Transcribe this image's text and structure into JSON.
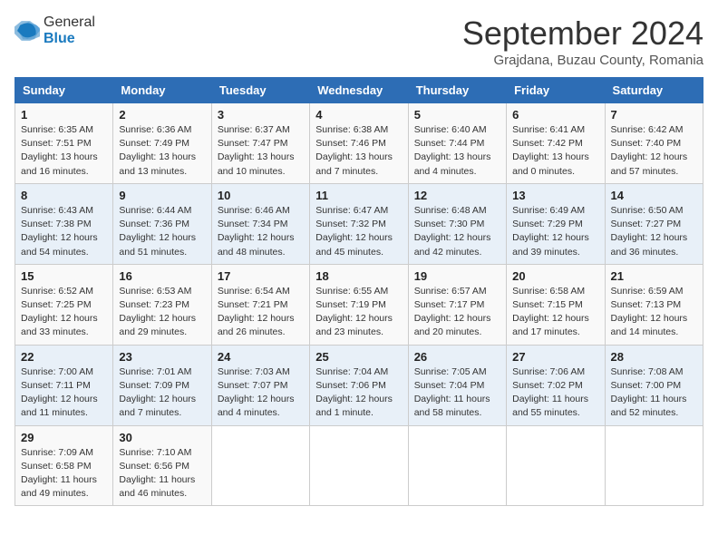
{
  "header": {
    "logo_general": "General",
    "logo_blue": "Blue",
    "title": "September 2024",
    "subtitle": "Grajdana, Buzau County, Romania"
  },
  "columns": [
    "Sunday",
    "Monday",
    "Tuesday",
    "Wednesday",
    "Thursday",
    "Friday",
    "Saturday"
  ],
  "weeks": [
    [
      {
        "day": "1",
        "sunrise": "Sunrise: 6:35 AM",
        "sunset": "Sunset: 7:51 PM",
        "daylight": "Daylight: 13 hours and 16 minutes."
      },
      {
        "day": "2",
        "sunrise": "Sunrise: 6:36 AM",
        "sunset": "Sunset: 7:49 PM",
        "daylight": "Daylight: 13 hours and 13 minutes."
      },
      {
        "day": "3",
        "sunrise": "Sunrise: 6:37 AM",
        "sunset": "Sunset: 7:47 PM",
        "daylight": "Daylight: 13 hours and 10 minutes."
      },
      {
        "day": "4",
        "sunrise": "Sunrise: 6:38 AM",
        "sunset": "Sunset: 7:46 PM",
        "daylight": "Daylight: 13 hours and 7 minutes."
      },
      {
        "day": "5",
        "sunrise": "Sunrise: 6:40 AM",
        "sunset": "Sunset: 7:44 PM",
        "daylight": "Daylight: 13 hours and 4 minutes."
      },
      {
        "day": "6",
        "sunrise": "Sunrise: 6:41 AM",
        "sunset": "Sunset: 7:42 PM",
        "daylight": "Daylight: 13 hours and 0 minutes."
      },
      {
        "day": "7",
        "sunrise": "Sunrise: 6:42 AM",
        "sunset": "Sunset: 7:40 PM",
        "daylight": "Daylight: 12 hours and 57 minutes."
      }
    ],
    [
      {
        "day": "8",
        "sunrise": "Sunrise: 6:43 AM",
        "sunset": "Sunset: 7:38 PM",
        "daylight": "Daylight: 12 hours and 54 minutes."
      },
      {
        "day": "9",
        "sunrise": "Sunrise: 6:44 AM",
        "sunset": "Sunset: 7:36 PM",
        "daylight": "Daylight: 12 hours and 51 minutes."
      },
      {
        "day": "10",
        "sunrise": "Sunrise: 6:46 AM",
        "sunset": "Sunset: 7:34 PM",
        "daylight": "Daylight: 12 hours and 48 minutes."
      },
      {
        "day": "11",
        "sunrise": "Sunrise: 6:47 AM",
        "sunset": "Sunset: 7:32 PM",
        "daylight": "Daylight: 12 hours and 45 minutes."
      },
      {
        "day": "12",
        "sunrise": "Sunrise: 6:48 AM",
        "sunset": "Sunset: 7:30 PM",
        "daylight": "Daylight: 12 hours and 42 minutes."
      },
      {
        "day": "13",
        "sunrise": "Sunrise: 6:49 AM",
        "sunset": "Sunset: 7:29 PM",
        "daylight": "Daylight: 12 hours and 39 minutes."
      },
      {
        "day": "14",
        "sunrise": "Sunrise: 6:50 AM",
        "sunset": "Sunset: 7:27 PM",
        "daylight": "Daylight: 12 hours and 36 minutes."
      }
    ],
    [
      {
        "day": "15",
        "sunrise": "Sunrise: 6:52 AM",
        "sunset": "Sunset: 7:25 PM",
        "daylight": "Daylight: 12 hours and 33 minutes."
      },
      {
        "day": "16",
        "sunrise": "Sunrise: 6:53 AM",
        "sunset": "Sunset: 7:23 PM",
        "daylight": "Daylight: 12 hours and 29 minutes."
      },
      {
        "day": "17",
        "sunrise": "Sunrise: 6:54 AM",
        "sunset": "Sunset: 7:21 PM",
        "daylight": "Daylight: 12 hours and 26 minutes."
      },
      {
        "day": "18",
        "sunrise": "Sunrise: 6:55 AM",
        "sunset": "Sunset: 7:19 PM",
        "daylight": "Daylight: 12 hours and 23 minutes."
      },
      {
        "day": "19",
        "sunrise": "Sunrise: 6:57 AM",
        "sunset": "Sunset: 7:17 PM",
        "daylight": "Daylight: 12 hours and 20 minutes."
      },
      {
        "day": "20",
        "sunrise": "Sunrise: 6:58 AM",
        "sunset": "Sunset: 7:15 PM",
        "daylight": "Daylight: 12 hours and 17 minutes."
      },
      {
        "day": "21",
        "sunrise": "Sunrise: 6:59 AM",
        "sunset": "Sunset: 7:13 PM",
        "daylight": "Daylight: 12 hours and 14 minutes."
      }
    ],
    [
      {
        "day": "22",
        "sunrise": "Sunrise: 7:00 AM",
        "sunset": "Sunset: 7:11 PM",
        "daylight": "Daylight: 12 hours and 11 minutes."
      },
      {
        "day": "23",
        "sunrise": "Sunrise: 7:01 AM",
        "sunset": "Sunset: 7:09 PM",
        "daylight": "Daylight: 12 hours and 7 minutes."
      },
      {
        "day": "24",
        "sunrise": "Sunrise: 7:03 AM",
        "sunset": "Sunset: 7:07 PM",
        "daylight": "Daylight: 12 hours and 4 minutes."
      },
      {
        "day": "25",
        "sunrise": "Sunrise: 7:04 AM",
        "sunset": "Sunset: 7:06 PM",
        "daylight": "Daylight: 12 hours and 1 minute."
      },
      {
        "day": "26",
        "sunrise": "Sunrise: 7:05 AM",
        "sunset": "Sunset: 7:04 PM",
        "daylight": "Daylight: 11 hours and 58 minutes."
      },
      {
        "day": "27",
        "sunrise": "Sunrise: 7:06 AM",
        "sunset": "Sunset: 7:02 PM",
        "daylight": "Daylight: 11 hours and 55 minutes."
      },
      {
        "day": "28",
        "sunrise": "Sunrise: 7:08 AM",
        "sunset": "Sunset: 7:00 PM",
        "daylight": "Daylight: 11 hours and 52 minutes."
      }
    ],
    [
      {
        "day": "29",
        "sunrise": "Sunrise: 7:09 AM",
        "sunset": "Sunset: 6:58 PM",
        "daylight": "Daylight: 11 hours and 49 minutes."
      },
      {
        "day": "30",
        "sunrise": "Sunrise: 7:10 AM",
        "sunset": "Sunset: 6:56 PM",
        "daylight": "Daylight: 11 hours and 46 minutes."
      },
      null,
      null,
      null,
      null,
      null
    ]
  ]
}
